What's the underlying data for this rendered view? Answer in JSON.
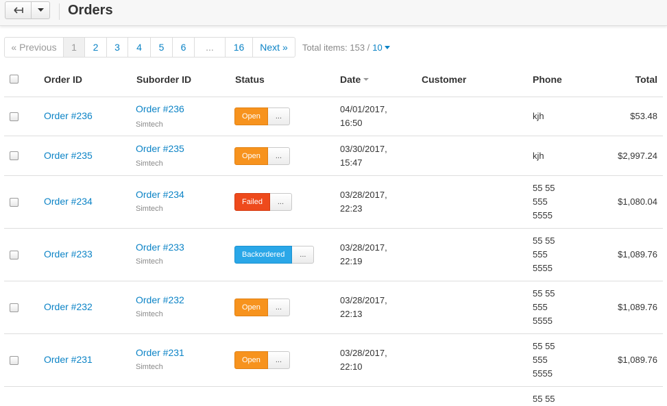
{
  "header": {
    "title": "Orders",
    "back_icon": "arrow-back-icon",
    "dropdown_icon": "caret-down-icon"
  },
  "pagination": {
    "prev_label": "« Previous",
    "pages": [
      "1",
      "2",
      "3",
      "4",
      "5",
      "6",
      "...",
      "16"
    ],
    "active_page": "1",
    "next_label": "Next »",
    "total_label": "Total items: 153 /",
    "per_page": "10"
  },
  "table": {
    "columns": {
      "order_id": "Order ID",
      "suborder_id": "Suborder ID",
      "status": "Status",
      "date": "Date",
      "customer": "Customer",
      "phone": "Phone",
      "total": "Total"
    },
    "rows": [
      {
        "order": "Order #236",
        "suborder": "Order #236",
        "company": "Simtech",
        "status": "Open",
        "date_line1": "04/01/2017,",
        "date_line2": "16:50",
        "customer": "",
        "phone": [
          "kjh"
        ],
        "total": "$53.48"
      },
      {
        "order": "Order #235",
        "suborder": "Order #235",
        "company": "Simtech",
        "status": "Open",
        "date_line1": "03/30/2017,",
        "date_line2": "15:47",
        "customer": "",
        "phone": [
          "kjh"
        ],
        "total": "$2,997.24"
      },
      {
        "order": "Order #234",
        "suborder": "Order #234",
        "company": "Simtech",
        "status": "Failed",
        "date_line1": "03/28/2017,",
        "date_line2": "22:23",
        "customer": "",
        "phone": [
          "55 55",
          "555",
          "5555"
        ],
        "total": "$1,080.04"
      },
      {
        "order": "Order #233",
        "suborder": "Order #233",
        "company": "Simtech",
        "status": "Backordered",
        "date_line1": "03/28/2017,",
        "date_line2": "22:19",
        "customer": "",
        "phone": [
          "55 55",
          "555",
          "5555"
        ],
        "total": "$1,089.76"
      },
      {
        "order": "Order #232",
        "suborder": "Order #232",
        "company": "Simtech",
        "status": "Open",
        "date_line1": "03/28/2017,",
        "date_line2": "22:13",
        "customer": "",
        "phone": [
          "55 55",
          "555",
          "5555"
        ],
        "total": "$1,089.76"
      },
      {
        "order": "Order #231",
        "suborder": "Order #231",
        "company": "Simtech",
        "status": "Open",
        "date_line1": "03/28/2017,",
        "date_line2": "22:10",
        "customer": "",
        "phone": [
          "55 55",
          "555",
          "5555"
        ],
        "total": "$1,089.76"
      }
    ],
    "partial_row_phone": "55 55",
    "status_more_label": "..."
  },
  "status_colors": {
    "Open": "#f7931e",
    "Failed": "#ee4a1c",
    "Backordered": "#2aa7e8"
  },
  "accent_link_color": "#0b83c6"
}
